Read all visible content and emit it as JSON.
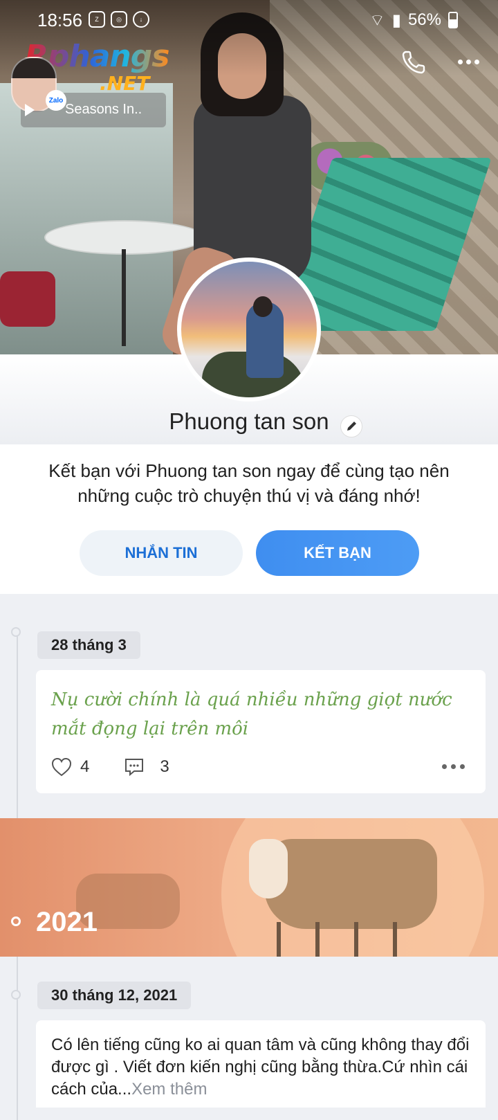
{
  "status_bar": {
    "time": "18:56",
    "battery": "56%",
    "app_icons": [
      "zalo-icon",
      "instagram-icon",
      "download-icon"
    ]
  },
  "watermark": {
    "brand": "Rphangs",
    "suffix": ".NET"
  },
  "cover": {
    "music_title": "Seasons In.."
  },
  "profile": {
    "name": "Phuong tan son"
  },
  "invite": {
    "text": "Kết bạn với Phuong tan son ngay để cùng tạo nên những cuộc trò chuyện thú vị và đáng nhớ!",
    "message_button": "NHẮN TIN",
    "add_friend_button": "KẾT BẠN"
  },
  "feed": {
    "posts": [
      {
        "date": "28 tháng 3",
        "text": "Nụ cười chính là quá nhiều những giọt nước mắt đọng lại trên môi",
        "likes": "4",
        "comments": "3"
      },
      {
        "date": "30 tháng 12, 2021",
        "text": "Có lên tiếng cũng ko ai quan tâm và cũng không thay đổi được gì . Viết đơn kiến nghị cũng bằng thừa.Cứ nhìn cái cách của...",
        "see_more": "Xem thêm"
      }
    ],
    "year_banner": "2021"
  },
  "colors": {
    "accent": "#3f8ef0",
    "post_text_green": "#6aa14c"
  }
}
